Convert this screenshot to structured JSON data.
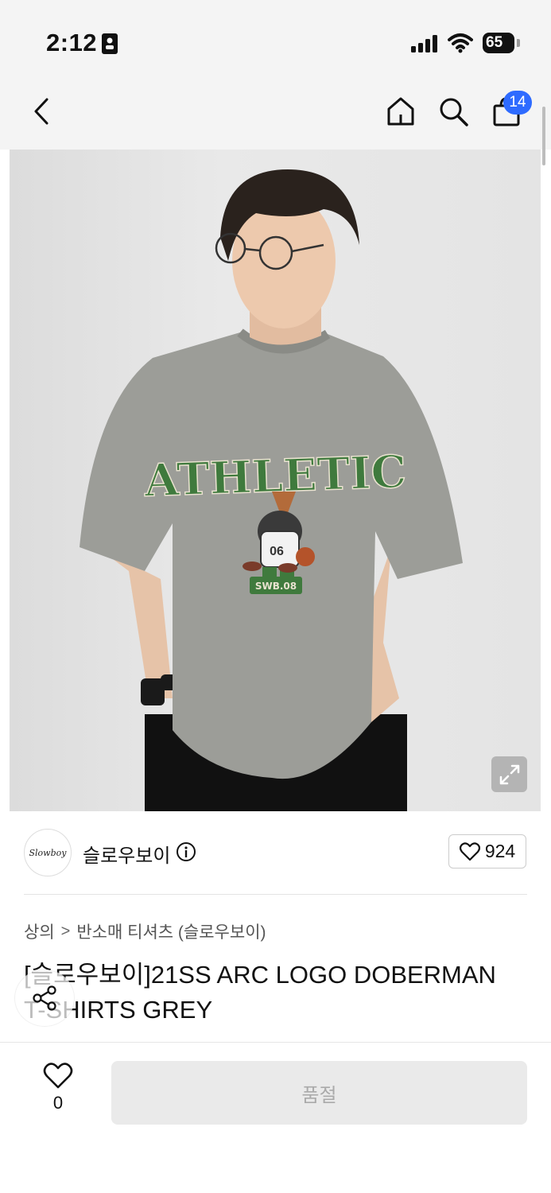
{
  "status": {
    "time": "2:12",
    "battery": "65"
  },
  "nav": {
    "cart_count": "14"
  },
  "product_image": {
    "shirt_text": "ATHLETIC",
    "shirt_badge": "SWB.08",
    "dog_number": "06"
  },
  "brand": {
    "logo_text": "Slowboy",
    "name": "슬로우보이",
    "like_count": "924"
  },
  "breadcrumb": {
    "level1": "상의",
    "separator": ">",
    "level2": "반소매 티셔츠 (슬로우보이)"
  },
  "product": {
    "title": "[슬로우보이]21SS ARC LOGO DOBERMAN T-SHIRTS GREY"
  },
  "bottom_bar": {
    "wish_count": "0",
    "soldout_label": "품절"
  },
  "colors": {
    "accent": "#2e6bff",
    "shirt": "#9c9d98",
    "shirt_print": "#3f7a3d"
  }
}
